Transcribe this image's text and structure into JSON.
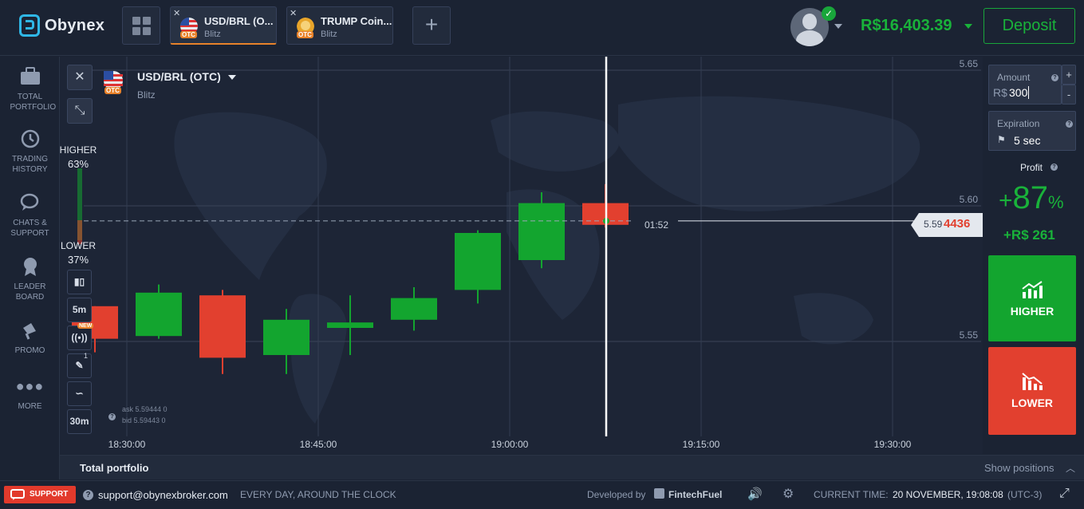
{
  "brand": {
    "name": "Obynex"
  },
  "header": {
    "tabs": [
      {
        "title": "USD/BRL (O...",
        "subtitle": "Blitz",
        "badge": "OTC",
        "active": true
      },
      {
        "title": "TRUMP Coin...",
        "subtitle": "Blitz",
        "badge": "OTC",
        "active": false
      }
    ],
    "add_tab_label": "+",
    "balance": "R$16,403.39",
    "deposit_label": "Deposit"
  },
  "sidebar": {
    "items": [
      {
        "label": "TOTAL PORTFOLIO",
        "icon": "briefcase-icon"
      },
      {
        "label": "TRADING HISTORY",
        "icon": "clock-history-icon"
      },
      {
        "label": "CHATS & SUPPORT",
        "icon": "chat-icon"
      },
      {
        "label": "LEADER BOARD",
        "icon": "trophy-icon"
      },
      {
        "label": "PROMO",
        "icon": "megaphone-icon"
      },
      {
        "label": "MORE",
        "icon": "more-dots-icon"
      }
    ]
  },
  "chart_header": {
    "pair": "USD/BRL (OTC)",
    "mode": "Blitz",
    "badge": "OTC"
  },
  "sentiment": {
    "higher_label": "HIGHER",
    "higher_pct": "63%",
    "lower_label": "LOWER",
    "lower_pct": "37%"
  },
  "tools": {
    "timeframe": "5m",
    "new_badge": "NEW",
    "drawing_count": "1",
    "period": "30m"
  },
  "quotes": {
    "ask": "ask 5.59444 0",
    "bid": "bid 5.59443 0"
  },
  "timer": "01:52",
  "current_price": {
    "prefix": "5.59",
    "suffix": "4436"
  },
  "colors": {
    "up": "#13a52f",
    "down": "#e2402f",
    "accent": "#19b23a",
    "tab_accent": "#e8822a"
  },
  "chart_data": {
    "type": "candlestick",
    "y_ticks": [
      5.65,
      5.6,
      5.55
    ],
    "y_tick_labels": [
      "5.65",
      "5.60",
      "5.55"
    ],
    "x_tick_labels": [
      "18:30:00",
      "18:45:00",
      "19:00:00",
      "19:15:00",
      "19:30:00"
    ],
    "ylim": [
      5.515,
      5.655
    ],
    "current_price": 5.594436,
    "candles": [
      {
        "open": 5.563,
        "close": 5.551,
        "high": 5.563,
        "low": 5.546
      },
      {
        "open": 5.552,
        "close": 5.568,
        "high": 5.571,
        "low": 5.551
      },
      {
        "open": 5.567,
        "close": 5.544,
        "high": 5.569,
        "low": 5.538
      },
      {
        "open": 5.545,
        "close": 5.558,
        "high": 5.562,
        "low": 5.538
      },
      {
        "open": 5.555,
        "close": 5.557,
        "high": 5.567,
        "low": 5.545
      },
      {
        "open": 5.558,
        "close": 5.566,
        "high": 5.57,
        "low": 5.554
      },
      {
        "open": 5.569,
        "close": 5.59,
        "high": 5.591,
        "low": 5.564
      },
      {
        "open": 5.58,
        "close": 5.601,
        "high": 5.605,
        "low": 5.577
      },
      {
        "open": 5.601,
        "close": 5.593,
        "high": 5.608,
        "low": 5.592
      }
    ]
  },
  "trade_panel": {
    "amount_label": "Amount",
    "amount_currency": "R$",
    "amount_value": "300",
    "plus": "+",
    "minus": "-",
    "expiration_label": "Expiration",
    "expiration_value": "5 sec",
    "profit_label": "Profit",
    "profit_sign": "+",
    "profit_pct": "87",
    "profit_pct_unit": "%",
    "profit_amount": "+R$ 261",
    "higher_label": "HIGHER",
    "lower_label": "LOWER"
  },
  "portfolio_bar": {
    "title": "Total portfolio",
    "show_positions": "Show positions"
  },
  "footer": {
    "support_label": "SUPPORT",
    "email": "support@obynexbroker.com",
    "hours": "EVERY DAY, AROUND THE CLOCK",
    "developed_by": "Developed by",
    "developer": "FintechFuel",
    "current_time_label": "CURRENT TIME:",
    "current_time_value": "20 NOVEMBER, 19:08:08",
    "timezone": "(UTC-3)"
  }
}
